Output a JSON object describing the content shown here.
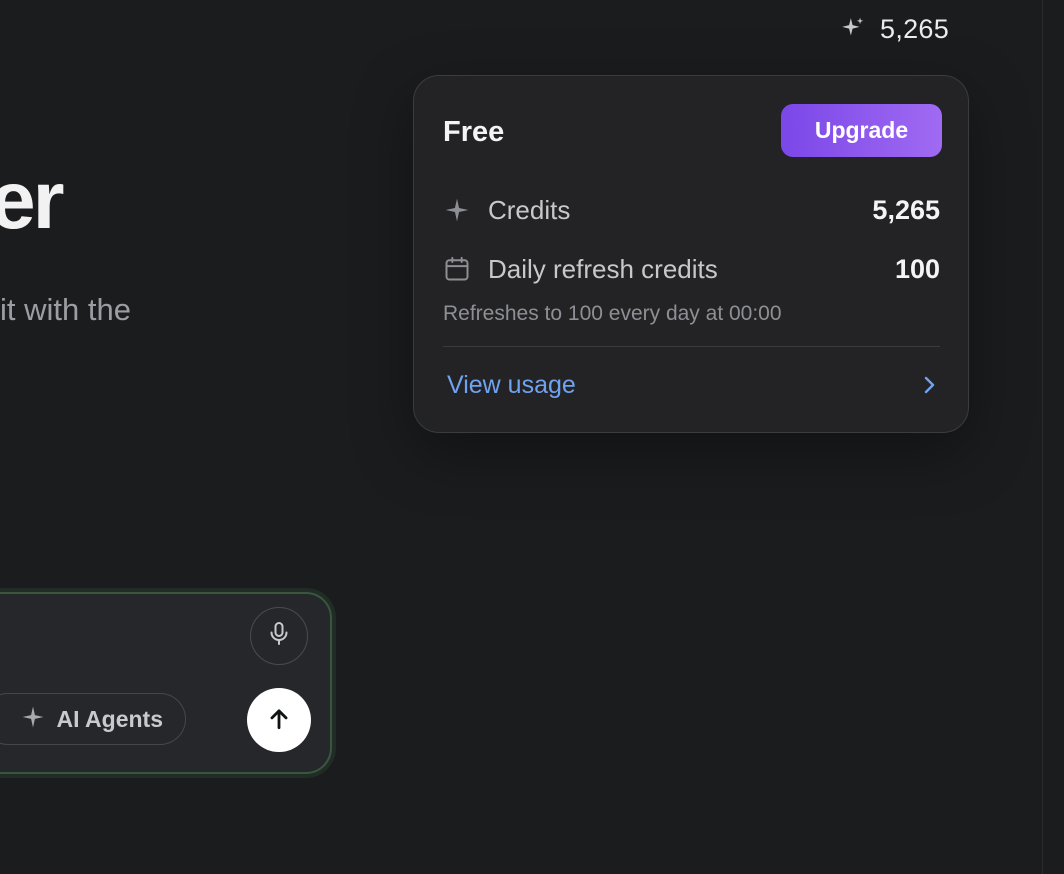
{
  "header": {
    "credits_count": "5,265"
  },
  "hero": {
    "title_fragment": "er",
    "subtitle_fragment": "it with the"
  },
  "credits_popover": {
    "plan_name": "Free",
    "upgrade_label": "Upgrade",
    "credits_label": "Credits",
    "credits_value": "5,265",
    "daily_label": "Daily refresh credits",
    "daily_value": "100",
    "refresh_note": "Refreshes to 100 every day at 00:00",
    "view_usage_label": "View usage"
  },
  "composer": {
    "agents_chip_label": "AI Agents"
  },
  "icons": {
    "sparkle": "sparkle-icon",
    "calendar": "calendar-icon",
    "chevron": "chevron-right-icon",
    "mic": "microphone-icon",
    "send": "arrow-up-icon"
  },
  "colors": {
    "background": "#1b1c1e",
    "card": "#232326",
    "upgrade_gradient_start": "#7b47e8",
    "upgrade_gradient_end": "#a06af2",
    "link": "#6fa3ef",
    "composer_border": "#39563f"
  }
}
